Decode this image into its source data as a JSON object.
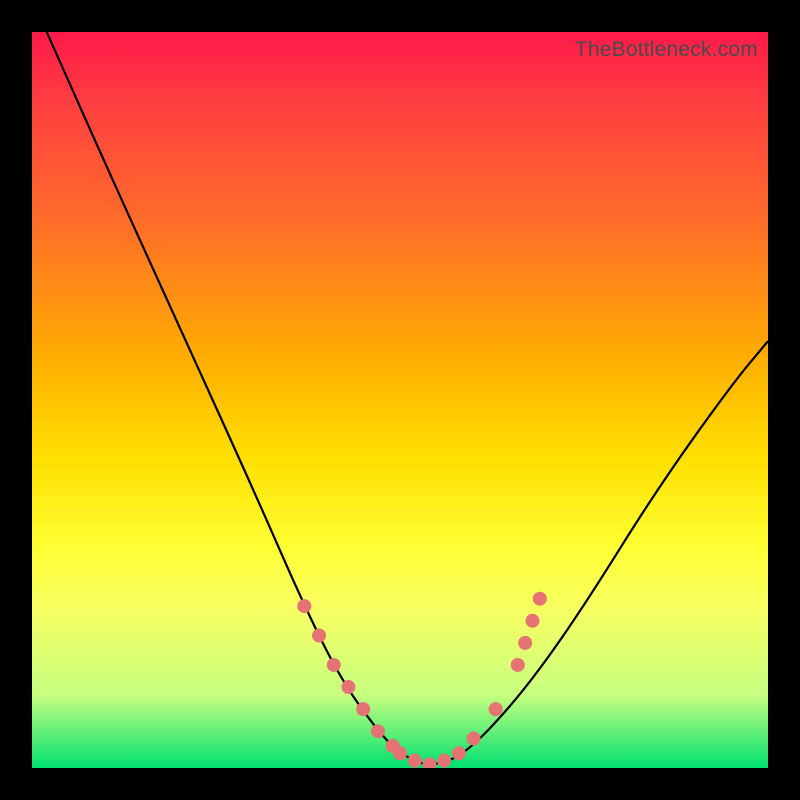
{
  "watermark": "TheBottleneck.com",
  "chart_data": {
    "type": "line",
    "title": "",
    "xlabel": "",
    "ylabel": "",
    "xlim": [
      0,
      100
    ],
    "ylim": [
      0,
      100
    ],
    "series": [
      {
        "name": "bottleneck-curve",
        "x": [
          2,
          10,
          20,
          30,
          37,
          42,
          47,
          50,
          53,
          55,
          58,
          62,
          68,
          75,
          85,
          95,
          100
        ],
        "values": [
          100,
          82,
          60,
          38,
          22,
          12,
          5,
          2,
          0.5,
          0.5,
          1.5,
          5,
          12,
          22,
          38,
          52,
          58
        ]
      }
    ],
    "markers": {
      "name": "highlight-dots",
      "points": [
        {
          "x": 37,
          "y": 22
        },
        {
          "x": 39,
          "y": 18
        },
        {
          "x": 41,
          "y": 14
        },
        {
          "x": 43,
          "y": 11
        },
        {
          "x": 45,
          "y": 8
        },
        {
          "x": 47,
          "y": 5
        },
        {
          "x": 49,
          "y": 3
        },
        {
          "x": 50,
          "y": 2
        },
        {
          "x": 52,
          "y": 1
        },
        {
          "x": 54,
          "y": 0.5
        },
        {
          "x": 56,
          "y": 1
        },
        {
          "x": 58,
          "y": 2
        },
        {
          "x": 60,
          "y": 4
        },
        {
          "x": 63,
          "y": 8
        },
        {
          "x": 66,
          "y": 14
        },
        {
          "x": 67,
          "y": 17
        },
        {
          "x": 68,
          "y": 20
        },
        {
          "x": 69,
          "y": 23
        }
      ],
      "color": "#e57373"
    },
    "gradient_stops": [
      {
        "pos": 0,
        "color": "#ff1a4a"
      },
      {
        "pos": 25,
        "color": "#ff6a2a"
      },
      {
        "pos": 50,
        "color": "#ffc800"
      },
      {
        "pos": 70,
        "color": "#ffff33"
      },
      {
        "pos": 100,
        "color": "#00e070"
      }
    ]
  }
}
